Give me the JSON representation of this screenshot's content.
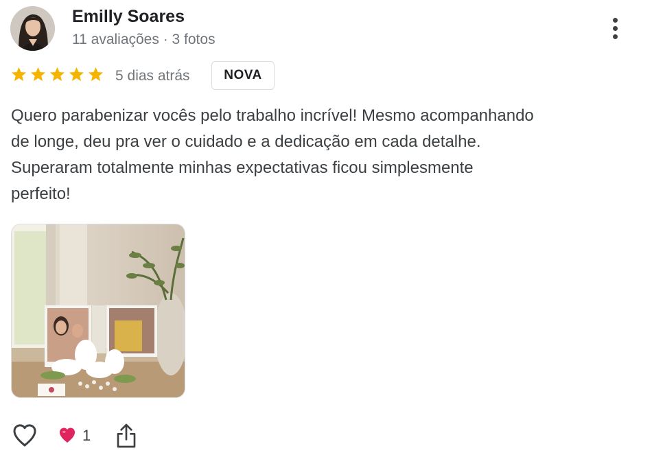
{
  "reviewer": {
    "name": "Emilly Soares",
    "stats": "11 avaliações · 3 fotos"
  },
  "rating": {
    "stars": 5,
    "max": 5,
    "star_color": "#f4b400"
  },
  "date": "5 dias atrás",
  "badge": "NOVA",
  "review_lines": [
    "Quero parabenizar vocês pelo trabalho incrível! Mesmo acompanhando",
    "de longe, deu pra ver o cuidado e a dedicação em cada detalhe.",
    "Superaram totalmente minhas expectativas ficou simplesmente",
    "perfeito!"
  ],
  "actions": {
    "like_icon": "heart-outline-icon",
    "reaction_icon": "red-heart-icon",
    "reaction_count": "1",
    "share_icon": "share-icon"
  },
  "icons": {
    "more": "more-vert-icon"
  },
  "colors": {
    "reaction": "#e0245e",
    "text": "#3c4043",
    "muted": "#70757a"
  }
}
